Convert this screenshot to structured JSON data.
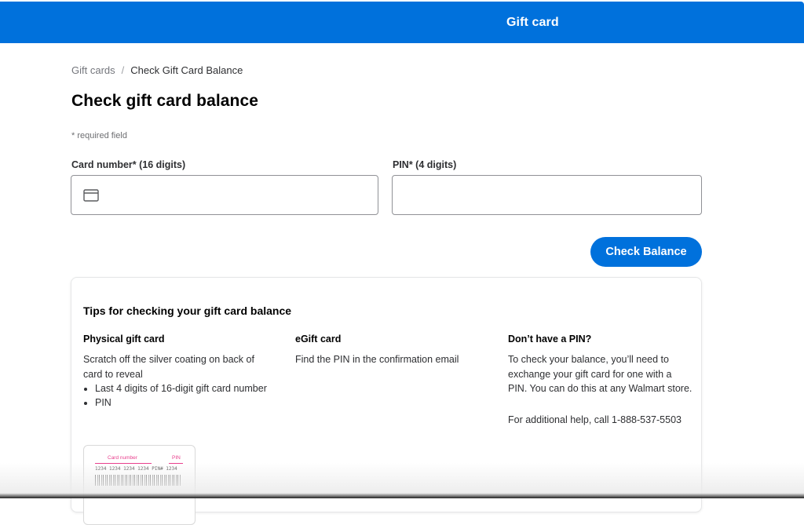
{
  "header": {
    "title": "Gift card",
    "bg_color": "#0071dc"
  },
  "breadcrumb": {
    "items": [
      "Gift cards",
      "Check Gift Card Balance"
    ],
    "separator": "/"
  },
  "page": {
    "title": "Check gift card balance",
    "required_note": "* required field"
  },
  "form": {
    "card_number": {
      "label": "Card number* (16 digits)",
      "value": "",
      "placeholder": "",
      "icon": "credit-card-icon"
    },
    "pin": {
      "label": "PIN* (4 digits)",
      "value": "",
      "placeholder": ""
    },
    "submit_label": "Check Balance",
    "accent": "#0071dc"
  },
  "tips": {
    "title": "Tips for checking your gift card balance",
    "physical": {
      "heading": "Physical gift card",
      "text": "Scratch off the silver coating on back of card to reveal",
      "bullets": [
        "Last 4 digits of 16-digit gift card number",
        "PIN"
      ]
    },
    "egift": {
      "heading": "eGift card",
      "text": "Find the PIN in the confirmation email"
    },
    "no_pin": {
      "heading": "Don’t have a PIN?",
      "text": "To check your balance, you’ll need to exchange your gift card for one with a PIN. You can do this at any Walmart store.",
      "help": "For additional help, call 1-888-537-5503"
    },
    "illustration": {
      "card_number_label": "Card number",
      "pin_label": "PIN",
      "digits": "1234  1234  1234  1234    PIN# 1234"
    }
  }
}
